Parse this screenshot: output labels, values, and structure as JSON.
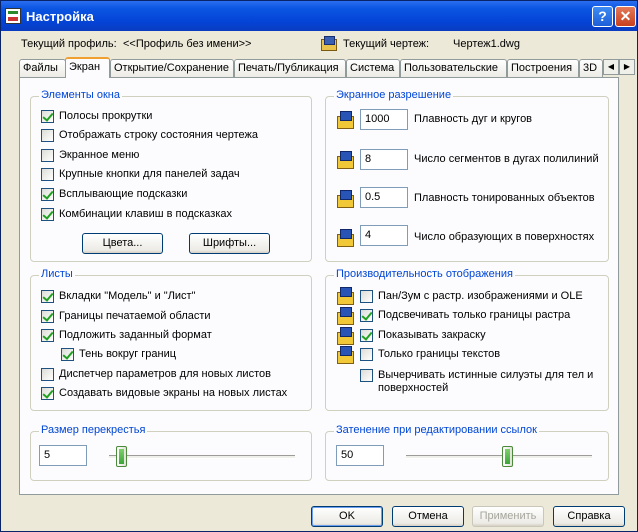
{
  "window": {
    "title": "Настройка"
  },
  "profile": {
    "label": "Текущий профиль:",
    "value": "<<Профиль без имени>>",
    "drawing_label": "Текущий чертеж:",
    "drawing_value": "Чертеж1.dwg"
  },
  "tabs": [
    "Файлы",
    "Экран",
    "Открытие/Сохранение",
    "Печать/Публикация",
    "Система",
    "Пользовательские",
    "Построения",
    "3D"
  ],
  "active_tab": "Экран",
  "window_elements": {
    "title": "Элементы окна",
    "options": [
      {
        "label": "Полосы прокрутки",
        "checked": true
      },
      {
        "label": "Отображать строку состояния чертежа",
        "checked": false
      },
      {
        "label": "Экранное меню",
        "checked": false
      },
      {
        "label": "Крупные кнопки для панелей задач",
        "checked": false
      },
      {
        "label": "Всплывающие подсказки",
        "checked": true
      },
      {
        "label": "Комбинации клавиш в подсказках",
        "checked": true
      }
    ],
    "colors_button": "Цвета...",
    "fonts_button": "Шрифты..."
  },
  "screen_resolution": {
    "title": "Экранное разрешение",
    "fields": [
      {
        "value": "1000",
        "label": "Плавность дуг и кругов"
      },
      {
        "value": "8",
        "label": "Число сегментов в дугах полилиний"
      },
      {
        "value": "0.5",
        "label": "Плавность тонированных объектов"
      },
      {
        "value": "4",
        "label": "Число образующих в поверхностях"
      }
    ]
  },
  "layouts": {
    "title": "Листы",
    "options": [
      {
        "label": "Вкладки \"Модель\" и \"Лист\"",
        "checked": true
      },
      {
        "label": "Границы печатаемой области",
        "checked": true
      },
      {
        "label": "Подложить заданный формат",
        "checked": true
      },
      {
        "label": "Тень вокруг границ",
        "checked": true
      },
      {
        "label": "Диспетчер параметров для новых листов",
        "checked": false
      },
      {
        "label": "Создавать видовые экраны на новых листах",
        "checked": true
      }
    ]
  },
  "display_performance": {
    "title": "Производительность отображения",
    "options": [
      {
        "label": "Пан/Зум с растр. изображениями и OLE",
        "checked": false
      },
      {
        "label": "Подсвечивать только границы растра",
        "checked": true
      },
      {
        "label": "Показывать закраску",
        "checked": true
      },
      {
        "label": "Только границы текстов",
        "checked": false
      },
      {
        "label": "Вычерчивать истинные силуэты для тел и поверхностей",
        "checked": false
      }
    ]
  },
  "crosshair": {
    "title": "Размер перекрестья",
    "value": "5",
    "level_percent": 5
  },
  "xref_fading": {
    "title": "Затенение при редактировании ссылок",
    "value": "50",
    "level_percent": 50
  },
  "buttons": {
    "ok": "OK",
    "cancel": "Отмена",
    "apply": "Применить",
    "help": "Справка"
  }
}
